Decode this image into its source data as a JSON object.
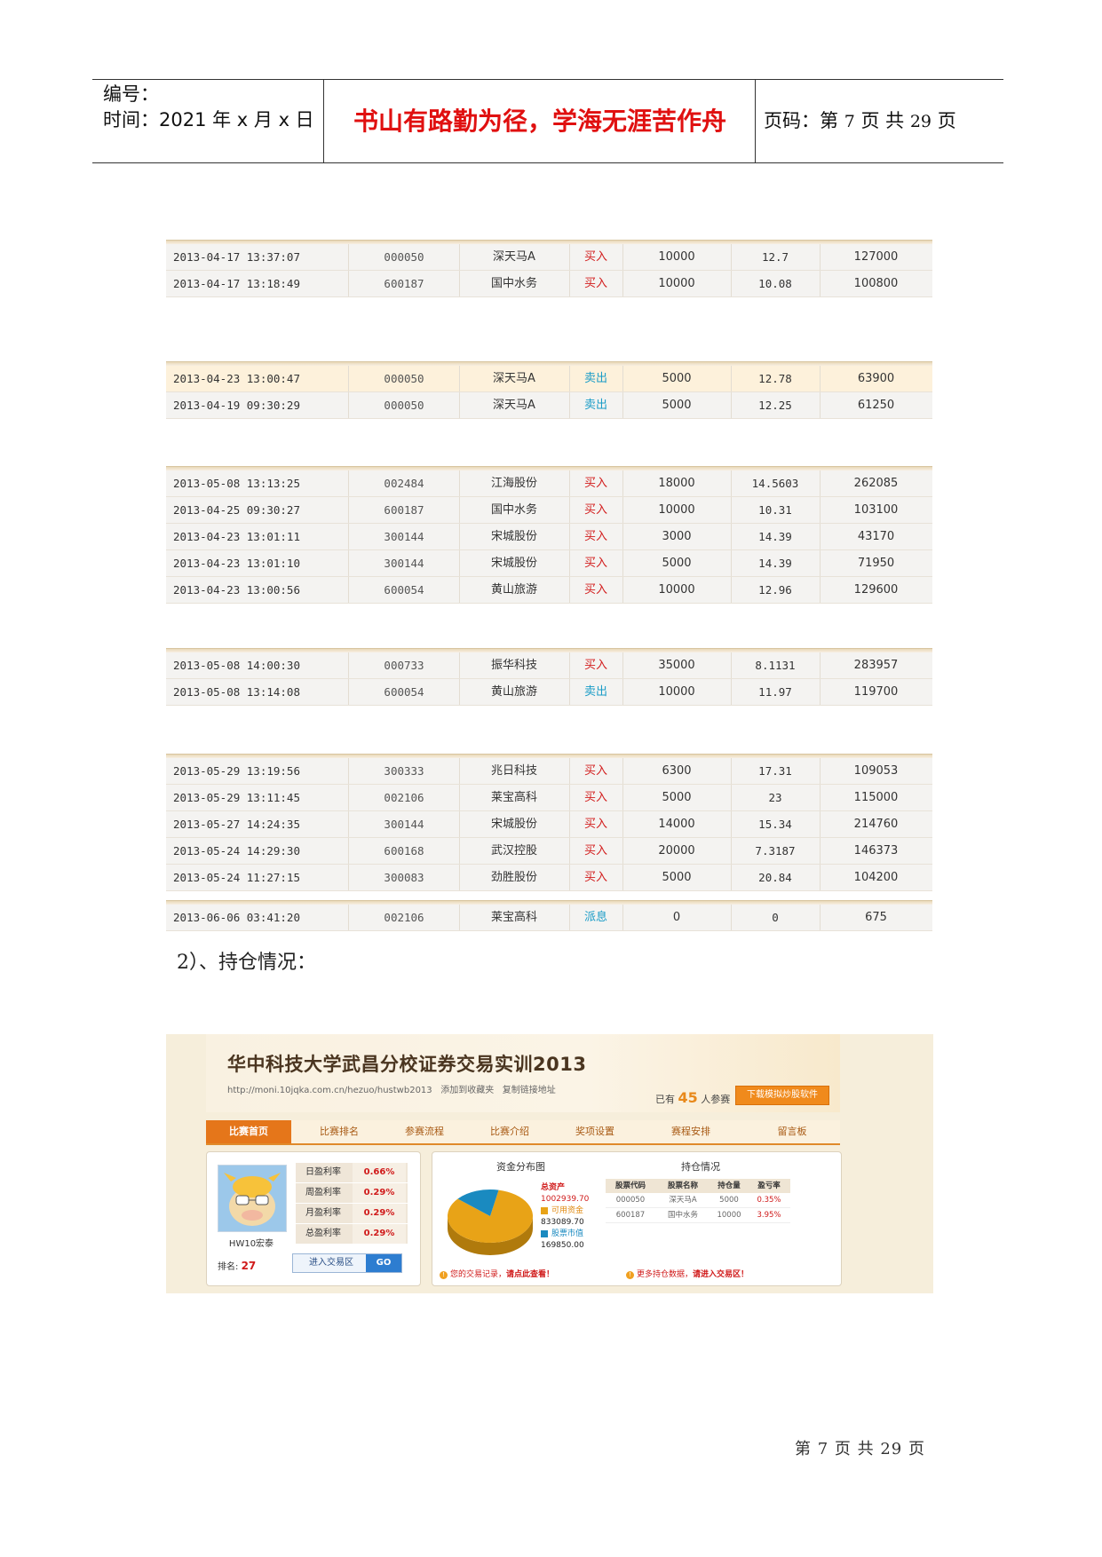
{
  "header": {
    "number_label": "编号：",
    "time_label": "时间：2021 年 x 月 x 日",
    "motto": "书山有路勤为径，学海无涯苦作舟",
    "page_prefix": "页码：第",
    "page_current": "7",
    "page_mid": "页  共",
    "page_total": "29",
    "page_suffix": "页"
  },
  "tables": [
    {
      "rows": [
        {
          "time": "2013-04-17 13:37:07",
          "code": "000050",
          "name": "深天马A",
          "action": "买入",
          "qty": "10000",
          "price": "12.7",
          "amount": "127000"
        },
        {
          "time": "2013-04-17 13:18:49",
          "code": "600187",
          "name": "国中水务",
          "action": "买入",
          "qty": "10000",
          "price": "10.08",
          "amount": "100800"
        }
      ]
    },
    {
      "rows": [
        {
          "time": "2013-04-23 13:00:47",
          "code": "000050",
          "name": "深天马A",
          "action": "卖出",
          "qty": "5000",
          "price": "12.78",
          "amount": "63900"
        },
        {
          "time": "2013-04-19 09:30:29",
          "code": "000050",
          "name": "深天马A",
          "action": "卖出",
          "qty": "5000",
          "price": "12.25",
          "amount": "61250"
        }
      ]
    },
    {
      "rows": [
        {
          "time": "2013-05-08 13:13:25",
          "code": "002484",
          "name": "江海股份",
          "action": "买入",
          "qty": "18000",
          "price": "14.5603",
          "amount": "262085"
        },
        {
          "time": "2013-04-25 09:30:27",
          "code": "600187",
          "name": "国中水务",
          "action": "买入",
          "qty": "10000",
          "price": "10.31",
          "amount": "103100"
        },
        {
          "time": "2013-04-23 13:01:11",
          "code": "300144",
          "name": "宋城股份",
          "action": "买入",
          "qty": "3000",
          "price": "14.39",
          "amount": "43170"
        },
        {
          "time": "2013-04-23 13:01:10",
          "code": "300144",
          "name": "宋城股份",
          "action": "买入",
          "qty": "5000",
          "price": "14.39",
          "amount": "71950"
        },
        {
          "time": "2013-04-23 13:00:56",
          "code": "600054",
          "name": "黄山旅游",
          "action": "买入",
          "qty": "10000",
          "price": "12.96",
          "amount": "129600"
        }
      ]
    },
    {
      "rows": [
        {
          "time": "2013-05-08 14:00:30",
          "code": "000733",
          "name": "振华科技",
          "action": "买入",
          "qty": "35000",
          "price": "8.1131",
          "amount": "283957"
        },
        {
          "time": "2013-05-08 13:14:08",
          "code": "600054",
          "name": "黄山旅游",
          "action": "卖出",
          "qty": "10000",
          "price": "11.97",
          "amount": "119700"
        }
      ]
    },
    {
      "rows": [
        {
          "time": "2013-05-29 13:19:56",
          "code": "300333",
          "name": "兆日科技",
          "action": "买入",
          "qty": "6300",
          "price": "17.31",
          "amount": "109053"
        },
        {
          "time": "2013-05-29 13:11:45",
          "code": "002106",
          "name": "莱宝高科",
          "action": "买入",
          "qty": "5000",
          "price": "23",
          "amount": "115000"
        },
        {
          "time": "2013-05-27 14:24:35",
          "code": "300144",
          "name": "宋城股份",
          "action": "买入",
          "qty": "14000",
          "price": "15.34",
          "amount": "214760"
        },
        {
          "time": "2013-05-24 14:29:30",
          "code": "600168",
          "name": "武汉控股",
          "action": "买入",
          "qty": "20000",
          "price": "7.3187",
          "amount": "146373"
        },
        {
          "time": "2013-05-24 11:27:15",
          "code": "300083",
          "name": "劲胜股份",
          "action": "买入",
          "qty": "5000",
          "price": "20.84",
          "amount": "104200"
        }
      ]
    },
    {
      "rows": [
        {
          "time": "2013-06-06 03:41:20",
          "code": "002106",
          "name": "莱宝高科",
          "action": "派息",
          "qty": "0",
          "price": "0",
          "amount": "675"
        }
      ]
    }
  ],
  "section_label": "2）、持仓情况：",
  "screenshot": {
    "title": "华中科技大学武昌分校证券交易实训2013",
    "url": "http://moni.10jqka.com.cn/hezuo/hustwb2013",
    "fav": "添加到收藏夹",
    "copy": "复制链接地址",
    "count_pre": "已有",
    "count": "45",
    "count_post": "人参赛",
    "download": "下载模拟炒股软件",
    "nav": [
      "比赛首页",
      "比赛排名",
      "参赛流程",
      "比赛介绍",
      "奖项设置",
      "赛程安排",
      "留言板"
    ],
    "username": "HW10宏泰",
    "stats": [
      {
        "k": "日盈利率",
        "v": "0.66%"
      },
      {
        "k": "周盈利率",
        "v": "0.29%"
      },
      {
        "k": "月盈利率",
        "v": "0.29%"
      },
      {
        "k": "总盈利率",
        "v": "0.29%"
      }
    ],
    "rank_label": "排名:",
    "rank": "27",
    "enter": "进入交易区",
    "go": "GO",
    "fund_title": "资金分布图",
    "total_assets_label": "总资产",
    "total_assets": "1002939.70",
    "cash_label": "可用资金",
    "cash": "833089.70",
    "stock_label": "股票市值",
    "stock": "169850.00",
    "fund_shares": [
      0.8306,
      0.1694
    ],
    "hold_title": "持仓情况",
    "hold_headers": [
      "股票代码",
      "股票名称",
      "持仓量",
      "盈亏率"
    ],
    "hold_rows": [
      [
        "000050",
        "深天马A",
        "5000",
        "0.35%"
      ],
      [
        "600187",
        "国中水务",
        "10000",
        "3.95%"
      ]
    ],
    "note1_pre": "您的交易记录，",
    "note1_em": "请点此查看！",
    "note2_pre": "更多持仓数据，",
    "note2_em": "请进入交易区！",
    "colors": {
      "accent": "#e5761a",
      "cash": "#e8a317",
      "stock": "#1a8ac0",
      "loss": "#d01a1a"
    }
  },
  "footer": "第 7 页 共 29 页"
}
